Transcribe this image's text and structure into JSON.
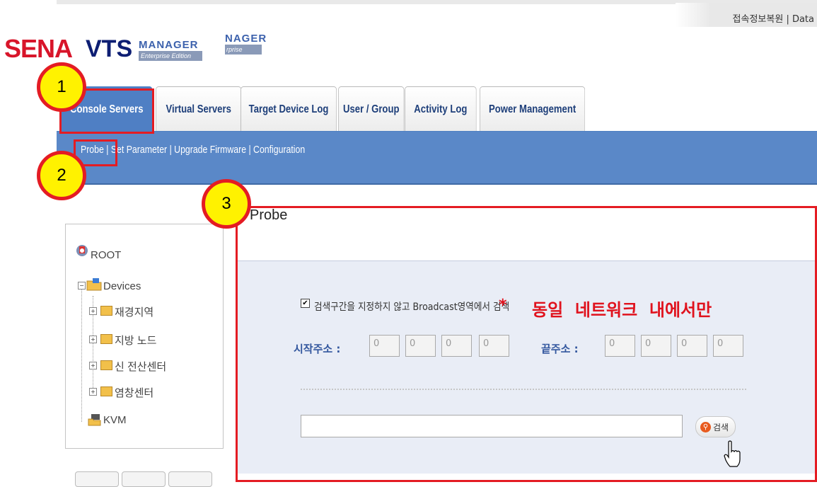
{
  "header": {
    "top_links": "접속정보복원 | Data",
    "logo": {
      "brand": "SENA",
      "product": "VTS",
      "manager": "MANAGER",
      "edition": "Enterprise Edition",
      "manager_ghost": "NAGER",
      "edition_ghost": "rprise Edition"
    }
  },
  "tabs": [
    {
      "label": "Console Servers",
      "active": true
    },
    {
      "label": "Virtual Servers",
      "active": false
    },
    {
      "label": "Target Device Log",
      "active": false
    },
    {
      "label": "User / Group",
      "active": false
    },
    {
      "label": "Activity Log",
      "active": false
    },
    {
      "label": "Power Management",
      "active": false
    }
  ],
  "subnav": {
    "text": "Probe | Set Parameter | Upgrade Firmware | Configuration"
  },
  "sidebar": {
    "root": "ROOT",
    "devices": "Devices",
    "children": [
      "재경지역",
      "지방 노드",
      "신 전산센터",
      "염창센터"
    ],
    "kvm": "KVM"
  },
  "probe": {
    "title": "Probe",
    "checkbox_mark": "✔",
    "checkbox_label": "검색구간을 지정하지 않고 Broadcast영역에서 검색",
    "note_star": "*",
    "note": "동일  네트워크  내에서만",
    "start_label": "시작주소 :",
    "end_label": "끝주소 :",
    "start_ip": [
      "0",
      "0",
      "0",
      "0"
    ],
    "end_ip": [
      "0",
      "0",
      "0",
      "0"
    ],
    "search_value": "",
    "search_button": "검색"
  },
  "annotations": {
    "badge1": "1",
    "badge2": "2",
    "badge3": "3",
    "highlight_color": "#e41c23",
    "badge_color": "#fff200"
  }
}
